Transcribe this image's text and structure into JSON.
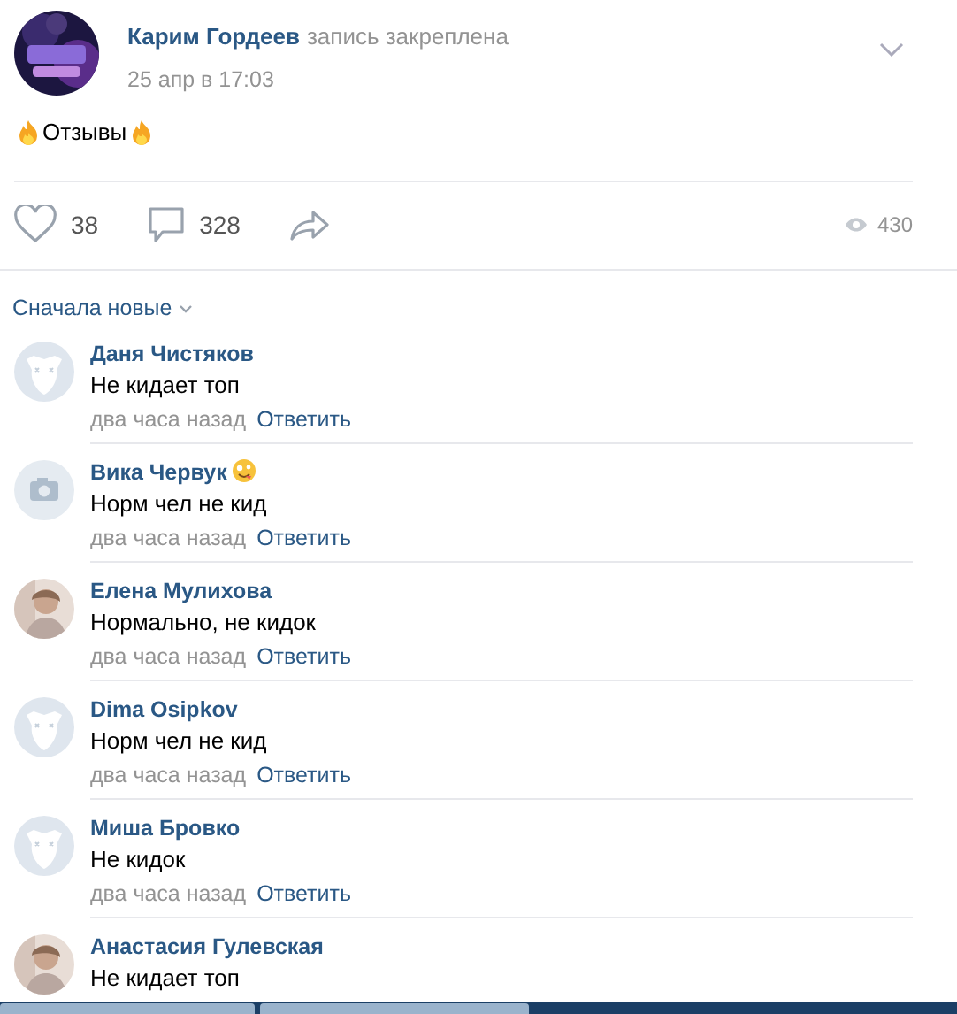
{
  "post": {
    "author": "Карим Гордеев",
    "note": "запись закреплена",
    "date": "25 апр в 17:03",
    "text": "Отзывы"
  },
  "actions": {
    "likes": "38",
    "comments": "328",
    "views": "430"
  },
  "sort": {
    "label": "Сначала новые"
  },
  "comments": [
    {
      "author": "Даня Чистяков",
      "text": "Не кидает топ",
      "time": "два часа назад",
      "reply": "Ответить",
      "kind": "default",
      "emoji": false
    },
    {
      "author": "Вика Червук",
      "text": "Норм чел не кид",
      "time": "два часа назад",
      "reply": "Ответить",
      "kind": "camera",
      "emoji": true
    },
    {
      "author": "Елена Мулихова",
      "text": "Нормально, не кидок",
      "time": "два часа назад",
      "reply": "Ответить",
      "emoji": false
    },
    {
      "author": "Dima Osipkov",
      "text": "Норм чел не кид",
      "time": "два часа назад",
      "reply": "Ответить",
      "kind": "default",
      "emoji": false
    },
    {
      "author": "Миша Бровко",
      "text": "Не кидок",
      "time": "два часа назад",
      "reply": "Ответить",
      "kind": "default",
      "emoji": false
    },
    {
      "author": "Анастасия Гулевская",
      "text": "Не кидает топ",
      "emoji": false
    }
  ]
}
